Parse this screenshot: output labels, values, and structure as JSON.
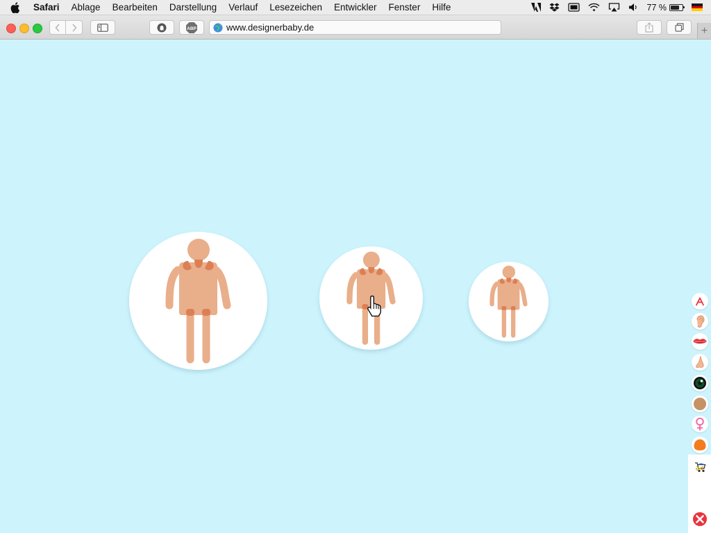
{
  "menubar": {
    "app_name": "Safari",
    "items": [
      "Ablage",
      "Bearbeiten",
      "Darstellung",
      "Verlauf",
      "Lesezeichen",
      "Entwickler",
      "Fenster",
      "Hilfe"
    ],
    "battery_text": "77 %",
    "battery_level": 0.77,
    "status_icons": [
      "adobe-icon",
      "dropbox-icon",
      "display-icon",
      "wifi-icon",
      "airplay-icon",
      "volume-icon",
      "battery-icon",
      "flag-de-icon"
    ]
  },
  "toolbar": {
    "url": "www.designerbaby.de",
    "extension_abp_label": "ABP"
  },
  "page": {
    "background": "#cdf4fd",
    "figures": [
      {
        "name": "figure-large"
      },
      {
        "name": "figure-medium"
      },
      {
        "name": "figure-small"
      }
    ],
    "skin_color": "#e9ae8a",
    "joint_color": "#dd7f55",
    "side_icons": [
      "text-color-icon",
      "ear-icon",
      "lips-icon",
      "nose-icon",
      "eye-color-icon",
      "skin-tone-icon",
      "female-gender-icon",
      "hair-color-icon",
      "stroller-icon",
      "close-icon"
    ]
  },
  "colors": {
    "accent_red": "#e8343f",
    "eye_green": "#0f4f2b",
    "skin_tone": "#c49264",
    "hair_orange": "#f27c1f",
    "female_pink": "#f06ea9"
  }
}
